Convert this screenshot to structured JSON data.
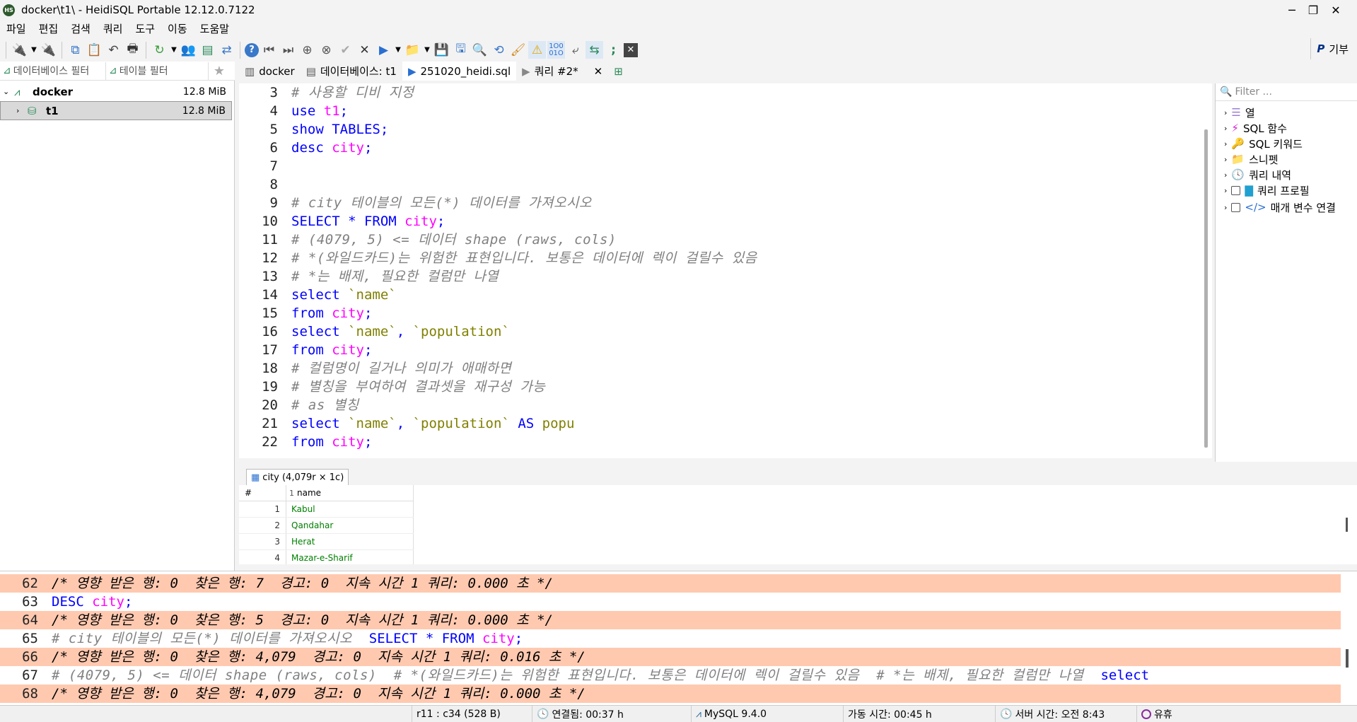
{
  "window": {
    "app_icon_text": "HS",
    "title": "docker\\t1\\ - HeidiSQL Portable 12.12.0.7122",
    "controls": {
      "minimize": "─",
      "maximize": "❐",
      "close": "✕"
    }
  },
  "menu": [
    "파일",
    "편집",
    "검색",
    "쿼리",
    "도구",
    "이동",
    "도움말"
  ],
  "toolbar": {
    "donate_label": "기부"
  },
  "left_panel": {
    "db_filter_placeholder": "데이터베이스 필터",
    "table_filter_placeholder": "테이블 필터",
    "tree": [
      {
        "label": "docker",
        "size": "12.8 MiB"
      },
      {
        "label": "t1",
        "size": "12.8 MiB"
      }
    ]
  },
  "tabs": [
    {
      "label": "docker"
    },
    {
      "label": "데이터베이스: t1"
    },
    {
      "label": "251020_heidi.sql"
    },
    {
      "label": "쿼리 #2*"
    }
  ],
  "editor": {
    "lines": [
      {
        "num": "3",
        "parts": [
          [
            "cm",
            "# 사용할 디비 지정"
          ]
        ]
      },
      {
        "num": "4",
        "parts": [
          [
            "kw",
            "use "
          ],
          [
            "id",
            "t1"
          ],
          [
            "kw",
            ";"
          ]
        ]
      },
      {
        "num": "5",
        "parts": [
          [
            "kw",
            "show TABLES;"
          ]
        ]
      },
      {
        "num": "6",
        "parts": [
          [
            "kw",
            "desc "
          ],
          [
            "id",
            "city"
          ],
          [
            "kw",
            ";"
          ]
        ]
      },
      {
        "num": "7",
        "parts": []
      },
      {
        "num": "8",
        "parts": []
      },
      {
        "num": "9",
        "parts": [
          [
            "cm",
            "# city 테이블의 모든(*) 데이터를 가져오시오"
          ]
        ]
      },
      {
        "num": "10",
        "parts": [
          [
            "kw",
            "SELECT * FROM "
          ],
          [
            "id",
            "city"
          ],
          [
            "kw",
            ";"
          ]
        ]
      },
      {
        "num": "11",
        "parts": [
          [
            "cm",
            "# (4079, 5) <= 데이터 shape (raws, cols)"
          ]
        ]
      },
      {
        "num": "12",
        "parts": [
          [
            "cm",
            "# *(와일드카드)는 위험한 표현입니다. 보통은 데이터에 렉이 걸릴수 있음"
          ]
        ]
      },
      {
        "num": "13",
        "parts": [
          [
            "cm",
            "# *는 배제, 필요한 컬럼만 나열"
          ]
        ]
      },
      {
        "num": "14",
        "parts": [
          [
            "kw",
            "select "
          ],
          [
            "str",
            "`name`"
          ]
        ]
      },
      {
        "num": "15",
        "parts": [
          [
            "kw",
            "from "
          ],
          [
            "id",
            "city"
          ],
          [
            "kw",
            ";"
          ]
        ]
      },
      {
        "num": "16",
        "parts": [
          [
            "kw",
            "select "
          ],
          [
            "str",
            "`name`"
          ],
          [
            "kw",
            ", "
          ],
          [
            "str",
            "`population`"
          ]
        ]
      },
      {
        "num": "17",
        "parts": [
          [
            "kw",
            "from "
          ],
          [
            "id",
            "city"
          ],
          [
            "kw",
            ";"
          ]
        ]
      },
      {
        "num": "18",
        "parts": [
          [
            "cm",
            "# 컬럼명이 길거나 의미가 애매하면"
          ]
        ]
      },
      {
        "num": "19",
        "parts": [
          [
            "cm",
            "# 별칭을 부여하여 결과셋을 재구성 가능"
          ]
        ]
      },
      {
        "num": "20",
        "parts": [
          [
            "cm",
            "# as 별칭"
          ]
        ]
      },
      {
        "num": "21",
        "parts": [
          [
            "kw",
            "select "
          ],
          [
            "str",
            "`name`"
          ],
          [
            "kw",
            ", "
          ],
          [
            "str",
            "`population`"
          ],
          [
            "kw",
            " AS "
          ],
          [
            "str",
            "popu"
          ]
        ]
      },
      {
        "num": "22",
        "parts": [
          [
            "kw",
            "from "
          ],
          [
            "id",
            "city"
          ],
          [
            "kw",
            ";"
          ]
        ]
      }
    ]
  },
  "helpers": {
    "filter_placeholder": "Filter ...",
    "items": [
      {
        "label": "열"
      },
      {
        "label": "SQL 함수"
      },
      {
        "label": "SQL 키워드"
      },
      {
        "label": "스니펫"
      },
      {
        "label": "쿼리 내역"
      },
      {
        "label": "쿼리 프로필"
      },
      {
        "label": "매개 변수 연결"
      }
    ]
  },
  "result": {
    "tab_label": "city (4,079r × 1c)",
    "header": {
      "num": "#",
      "col_index": "1",
      "col_name": "name"
    },
    "rows": [
      {
        "num": "1",
        "name": "Kabul"
      },
      {
        "num": "2",
        "name": "Qandahar"
      },
      {
        "num": "3",
        "name": "Herat"
      },
      {
        "num": "4",
        "name": "Mazar-e-Sharif"
      }
    ]
  },
  "log": {
    "lines": [
      {
        "num": "62",
        "hl": true,
        "parts": [
          [
            "lc",
            "/* 영향 받은 행: 0  찾은 행: 7  경고: 0  지속 시간 1 쿼리: 0.000 초 */"
          ]
        ]
      },
      {
        "num": "63",
        "hl": false,
        "parts": [
          [
            "kw",
            "DESC "
          ],
          [
            "id",
            "city"
          ],
          [
            "kw",
            ";"
          ]
        ]
      },
      {
        "num": "64",
        "hl": true,
        "parts": [
          [
            "lc",
            "/* 영향 받은 행: 0  찾은 행: 5  경고: 0  지속 시간 1 쿼리: 0.000 초 */"
          ]
        ]
      },
      {
        "num": "65",
        "hl": false,
        "parts": [
          [
            "cm",
            "# city 테이블의 모든(*) 데이터를 가져오시오  "
          ],
          [
            "kw",
            "SELECT * FROM "
          ],
          [
            "id",
            "city"
          ],
          [
            "kw",
            ";"
          ]
        ]
      },
      {
        "num": "66",
        "hl": true,
        "parts": [
          [
            "lc",
            "/* 영향 받은 행: 0  찾은 행: 4,079  경고: 0  지속 시간 1 쿼리: 0.016 초 */"
          ]
        ]
      },
      {
        "num": "67",
        "hl": false,
        "parts": [
          [
            "cm",
            "# (4079, 5) <= 데이터 shape (raws, cols)  # *(와일드카드)는 위험한 표현입니다. 보통은 데이터에 렉이 걸릴수 있음  # *는 배제, 필요한 컬럼만 나열  "
          ],
          [
            "kw",
            "select"
          ]
        ]
      },
      {
        "num": "68",
        "hl": true,
        "parts": [
          [
            "lc",
            "/* 영향 받은 행: 0  찾은 행: 4,079  경고: 0  지속 시간 1 쿼리: 0.000 초 */"
          ]
        ]
      }
    ]
  },
  "status": {
    "cursor": "r11 : c34 (528 B)",
    "connected": "연결됨: 00:37 h",
    "server": "MySQL 9.4.0",
    "uptime": "가동 시간: 00:45 h",
    "server_time": "서버 시간: 오전 8:43",
    "idle": "유휴"
  }
}
